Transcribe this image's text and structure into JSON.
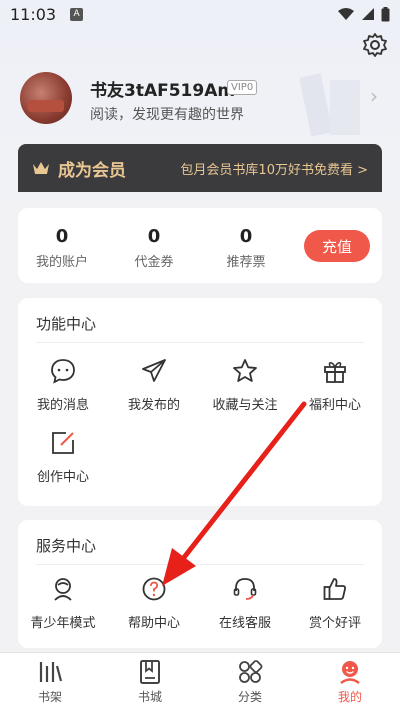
{
  "status_bar": {
    "time": "11:03",
    "notif_badge": "A"
  },
  "profile": {
    "nickname": "书友3tAF519Am",
    "vip_level": "VIP0",
    "slogan": "阅读，发现更有趣的世界"
  },
  "vip_banner": {
    "title": "成为会员",
    "promo": "包月会员书库10万好书免费看 >"
  },
  "account": {
    "stats": [
      {
        "value": "0",
        "label": "我的账户"
      },
      {
        "value": "0",
        "label": "代金券"
      },
      {
        "value": "0",
        "label": "推荐票"
      }
    ],
    "recharge_label": "充值"
  },
  "function_center": {
    "title": "功能中心",
    "items": [
      {
        "label": "我的消息",
        "icon": "message-icon"
      },
      {
        "label": "我发布的",
        "icon": "send-icon"
      },
      {
        "label": "收藏与关注",
        "icon": "star-icon"
      },
      {
        "label": "福利中心",
        "icon": "gift-icon"
      },
      {
        "label": "创作中心",
        "icon": "edit-icon"
      }
    ]
  },
  "service_center": {
    "title": "服务中心",
    "items": [
      {
        "label": "青少年模式",
        "icon": "teen-mode-icon"
      },
      {
        "label": "帮助中心",
        "icon": "help-icon"
      },
      {
        "label": "在线客服",
        "icon": "headset-icon"
      },
      {
        "label": "赏个好评",
        "icon": "thumbs-up-icon"
      }
    ]
  },
  "bottom_nav": {
    "items": [
      {
        "label": "书架",
        "icon": "bookshelf-icon",
        "active": false
      },
      {
        "label": "书城",
        "icon": "bookstore-icon",
        "active": false
      },
      {
        "label": "分类",
        "icon": "category-icon",
        "active": false
      },
      {
        "label": "我的",
        "icon": "profile-icon",
        "active": true
      }
    ]
  },
  "colors": {
    "accent": "#f0584a",
    "vip_gold": "#e9c793",
    "vip_bg": "#3b3a3d",
    "annotation_arrow": "#e8201a"
  }
}
